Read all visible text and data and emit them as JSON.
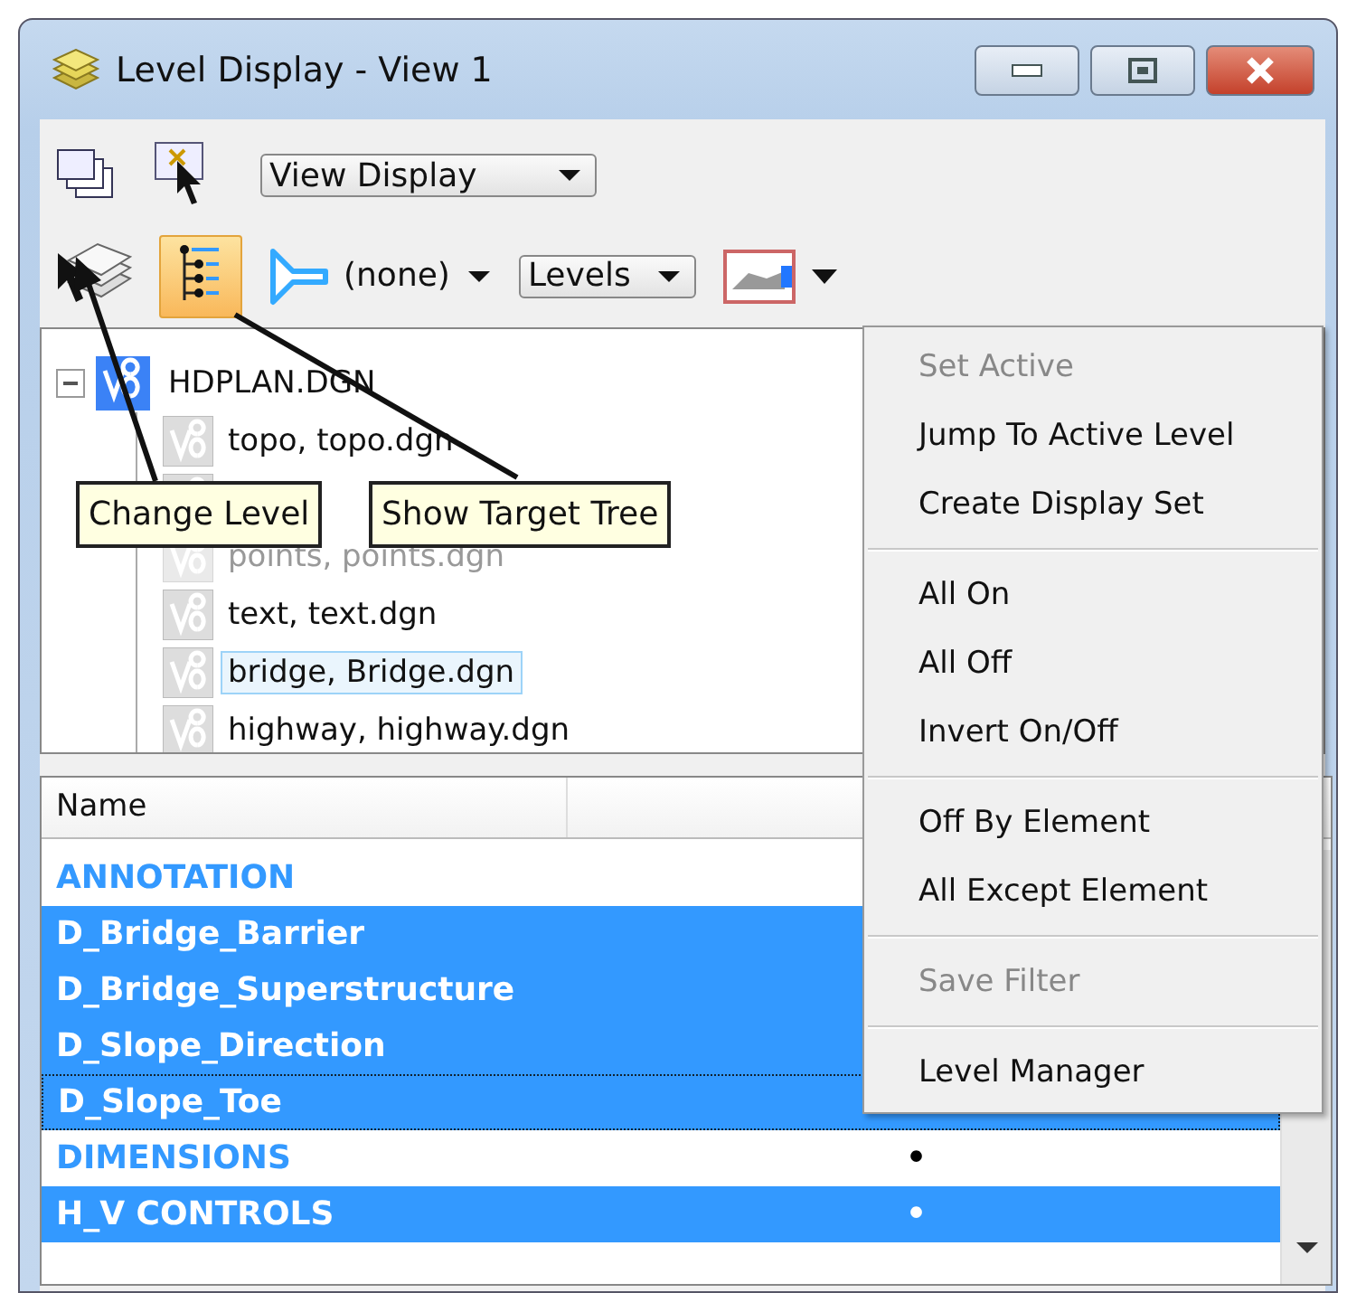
{
  "window": {
    "title": "Level Display - View 1"
  },
  "toolbar": {
    "view_dropdown": {
      "value": "View Display"
    },
    "target_tree_button": {
      "selected": true
    },
    "filter": {
      "value": "(none)"
    },
    "mode_dropdown": {
      "value": "Levels"
    }
  },
  "tree": {
    "root": {
      "label": "HDPLAN.DGN",
      "expanded": true,
      "children": [
        {
          "label": "topo, topo.dgn",
          "displayed": true,
          "selected": false
        },
        {
          "displayed": true,
          "selected": false
        },
        {
          "label": "points, points.dgn",
          "displayed": false,
          "selected": false
        },
        {
          "label": "text, text.dgn",
          "displayed": true,
          "selected": false
        },
        {
          "label": "bridge, Bridge.dgn",
          "displayed": true,
          "selected": true
        },
        {
          "label": "highway, highway.dgn",
          "displayed": true,
          "selected": false
        }
      ]
    }
  },
  "tooltips": [
    {
      "text": "Change Level"
    },
    {
      "text": "Show Target Tree"
    }
  ],
  "list": {
    "columns": [
      "Name"
    ],
    "rows": [
      {
        "name": "ANNOTATION",
        "selected": false,
        "focused": false
      },
      {
        "name": "D_Bridge_Barrier",
        "selected": true,
        "focused": false
      },
      {
        "name": "D_Bridge_Superstructure",
        "selected": true,
        "focused": false
      },
      {
        "name": "D_Slope_Direction",
        "selected": true,
        "focused": false
      },
      {
        "name": "D_Slope_Toe",
        "selected": true,
        "focused": true
      },
      {
        "name": "DIMENSIONS",
        "selected": false,
        "focused": false,
        "column_2": "•"
      },
      {
        "name": "H_V CONTROLS",
        "selected": true,
        "focused": false,
        "column_2": "•"
      }
    ]
  },
  "context_menu": {
    "items": [
      {
        "kind": "item",
        "label": "Set Active",
        "disabled": true
      },
      {
        "kind": "item",
        "label": "Jump To Active Level",
        "disabled": false
      },
      {
        "kind": "item",
        "label": "Create Display Set",
        "disabled": false
      },
      {
        "kind": "separator"
      },
      {
        "kind": "item",
        "label": "All On",
        "disabled": false
      },
      {
        "kind": "item",
        "label": "All Off",
        "disabled": false
      },
      {
        "kind": "item",
        "label": "Invert On/Off",
        "disabled": false
      },
      {
        "kind": "separator"
      },
      {
        "kind": "item",
        "label": "Off By Element",
        "disabled": false
      },
      {
        "kind": "item",
        "label": "All Except Element",
        "disabled": false
      },
      {
        "kind": "separator"
      },
      {
        "kind": "item",
        "label": "Save Filter",
        "disabled": true
      },
      {
        "kind": "separator"
      },
      {
        "kind": "item",
        "label": "Level Manager",
        "disabled": false
      }
    ]
  }
}
